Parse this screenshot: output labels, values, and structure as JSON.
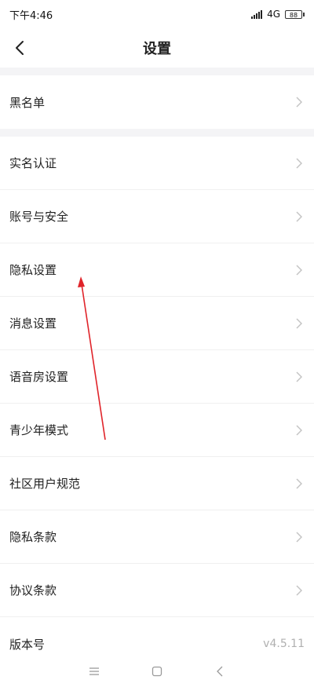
{
  "status_bar": {
    "time": "下午4:46",
    "network": "4G",
    "battery": "88"
  },
  "header": {
    "title": "设置"
  },
  "settings": {
    "group1": [
      {
        "label": "黑名单"
      }
    ],
    "group2": [
      {
        "label": "实名认证"
      },
      {
        "label": "账号与安全"
      },
      {
        "label": "隐私设置"
      },
      {
        "label": "消息设置"
      },
      {
        "label": "语音房设置"
      },
      {
        "label": "青少年模式"
      },
      {
        "label": "社区用户规范"
      },
      {
        "label": "隐私条款"
      },
      {
        "label": "协议条款"
      }
    ],
    "version": {
      "label": "版本号",
      "value": "v4.5.11"
    }
  },
  "colors": {
    "background": "#ffffff",
    "section_gap": "#f4f4f6",
    "text": "#222222",
    "secondary_text": "#b0b0b0",
    "annotation_arrow": "#e0242a"
  },
  "icons": {
    "back": "chevron-left-icon",
    "row_chevron": "chevron-right-icon",
    "nav_menu": "menu-icon",
    "nav_home": "home-square-icon",
    "nav_back": "back-triangle-icon"
  }
}
